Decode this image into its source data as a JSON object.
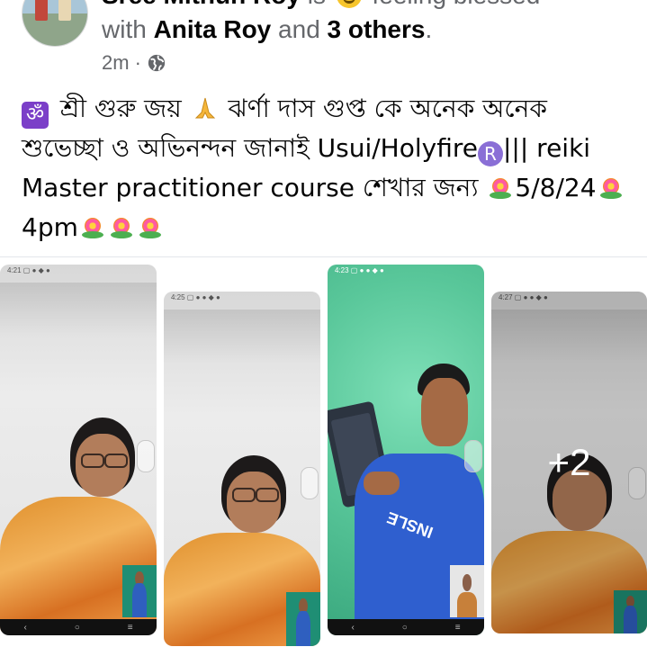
{
  "post": {
    "author": "Sree Mithun Roy",
    "feeling_prefix": "is",
    "feeling": "feeling blessed",
    "with_prefix": "with",
    "tagged": "Anita Roy",
    "and_text": "and",
    "others": "3 others",
    "period": ".",
    "time": "2m",
    "dot": "·",
    "text_line1_a": "শ্রী গুরু জয়",
    "text_line1_b": "ঝর্ণা দাস গুপ্ত কে অনেক অনেক",
    "text_line2_a": "শুভেচ্ছা ও অভিনন্দন জানাই Usui/Holyfire",
    "text_line2_b": "||| reiki",
    "text_line3_a": "Master practitioner course শেখার জন্য",
    "text_line3_b": "5/8/24",
    "text_line4": "4pm",
    "om_symbol": "ॐ",
    "reg_symbol": "R"
  },
  "media": {
    "more_count": "+2",
    "nav_back": "‹",
    "nav_home": "○",
    "nav_recent": "≡"
  },
  "icons": [
    "avatar",
    "smile-emoji-icon",
    "globe-icon",
    "om-icon",
    "pray-icon",
    "registered-icon",
    "flower-icon"
  ]
}
